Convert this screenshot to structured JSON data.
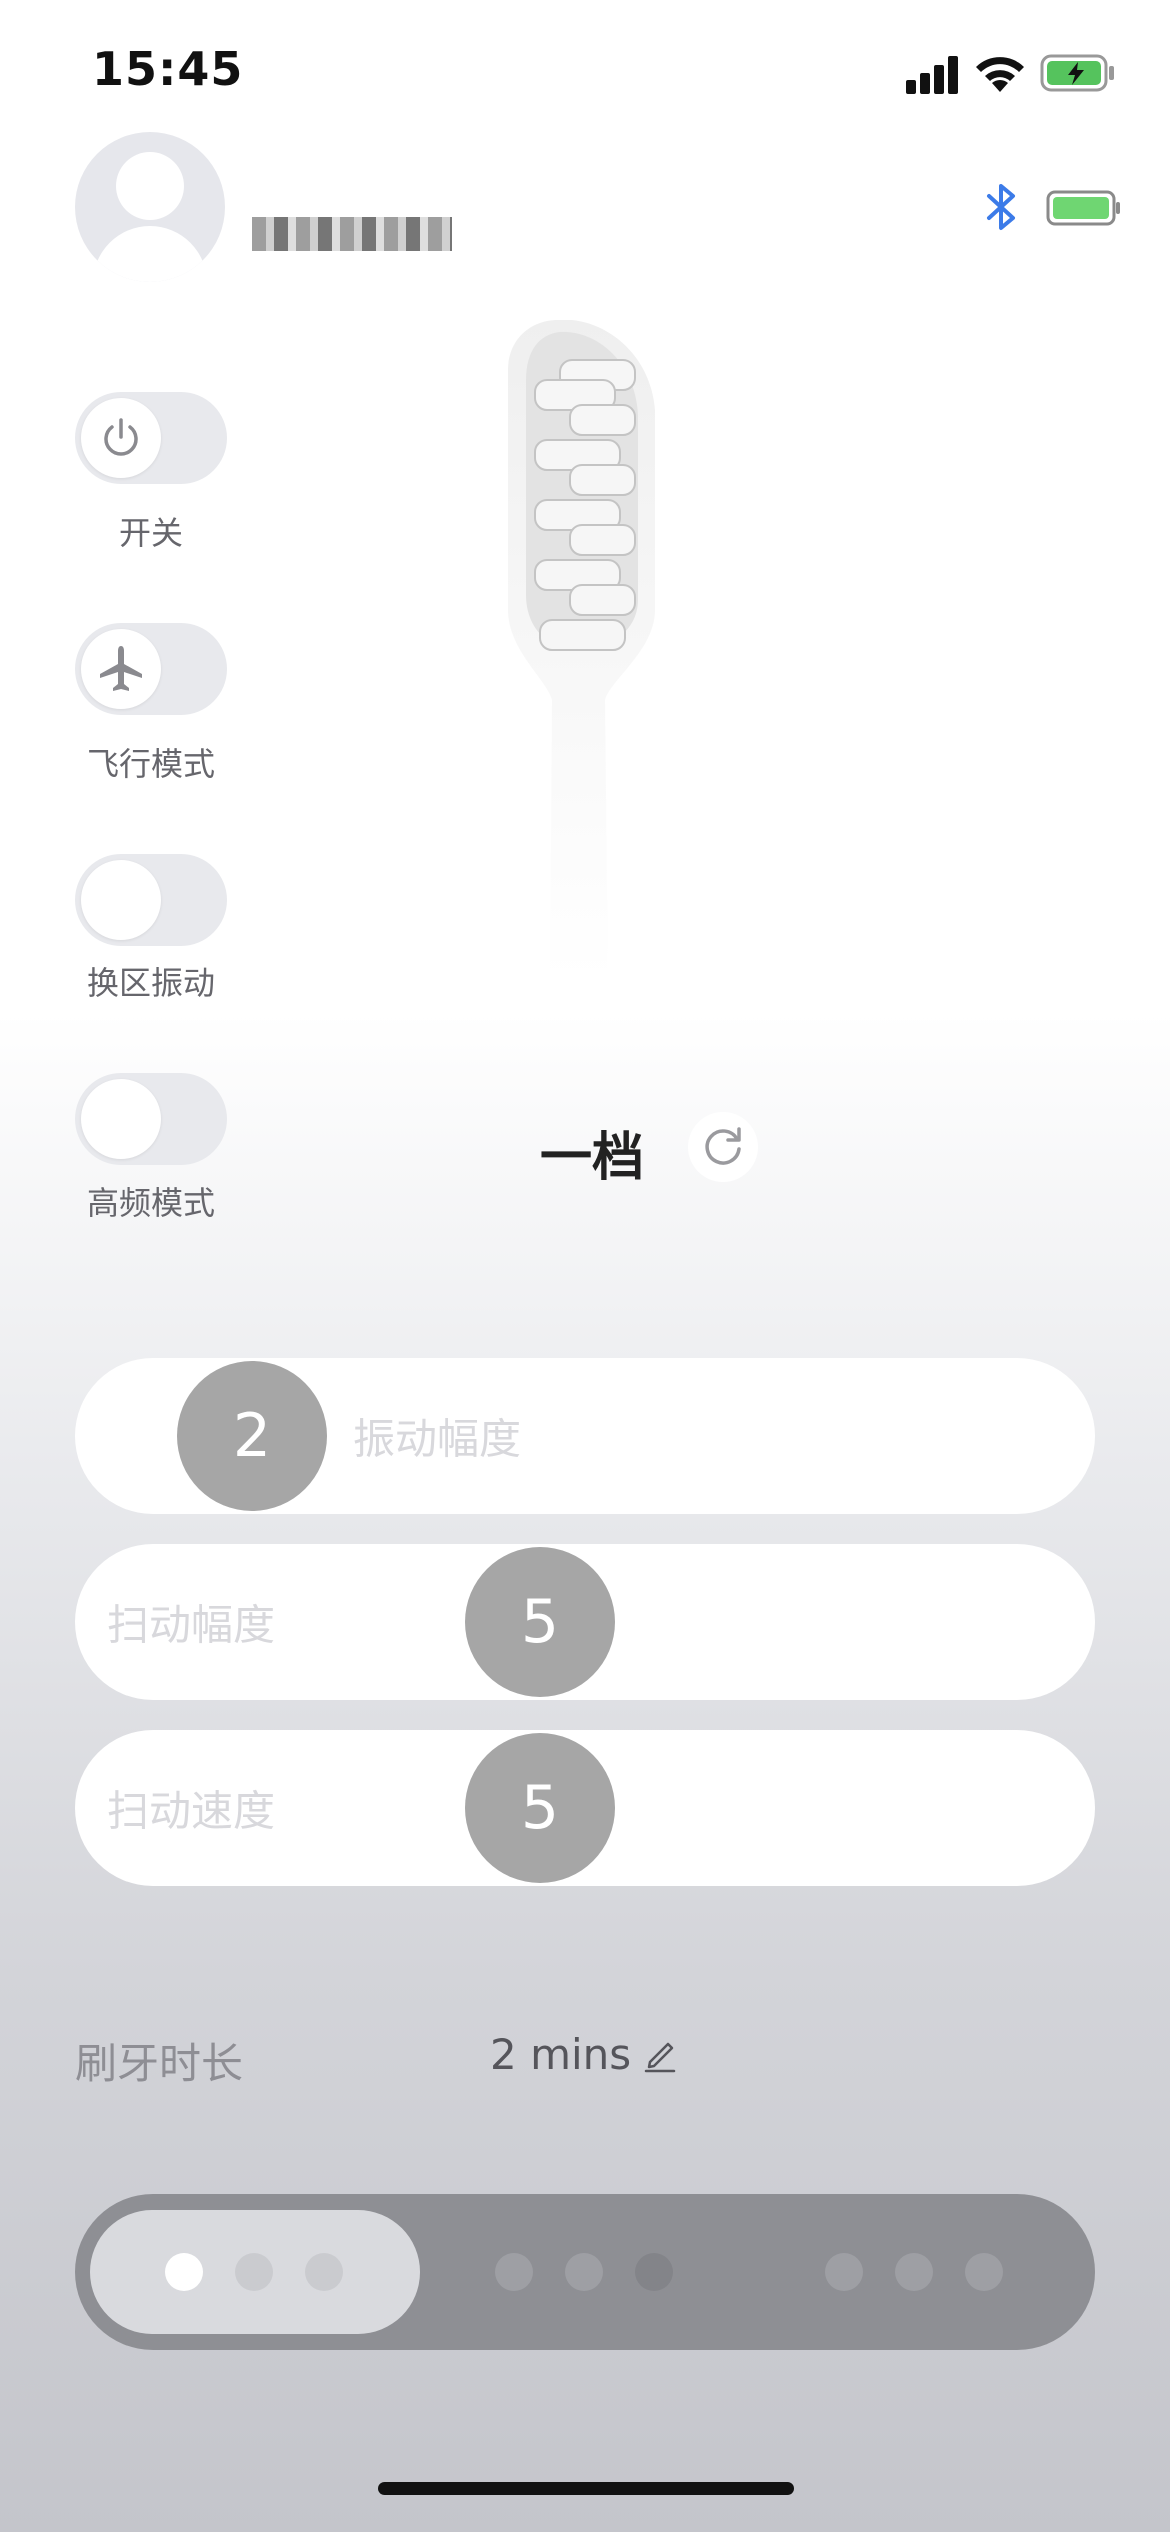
{
  "status_bar": {
    "time": "15:45"
  },
  "header": {
    "username": "■■■■■■",
    "bluetooth_icon": "bluetooth-icon",
    "device_battery_color": "#6fd672"
  },
  "toggles": [
    {
      "label": "开关",
      "icon": "power-icon",
      "on": false
    },
    {
      "label": "飞行模式",
      "icon": "airplane-icon",
      "on": false
    },
    {
      "label": "换区振动",
      "on": false
    },
    {
      "label": "高频模式",
      "on": false
    }
  ],
  "mode": {
    "label": "一档",
    "reset_icon": "refresh-icon"
  },
  "sliders": [
    {
      "label": "振动幅度",
      "value": "2"
    },
    {
      "label": "扫动幅度",
      "value": "5"
    },
    {
      "label": "扫动速度",
      "value": "5"
    }
  ],
  "duration": {
    "label": "刷牙时长",
    "value": "2 mins",
    "edit_icon": "pencil-icon"
  },
  "mode_selector": {
    "groups": 3,
    "dots_per_group": 3,
    "active_group": 1,
    "active_dot": 1
  }
}
